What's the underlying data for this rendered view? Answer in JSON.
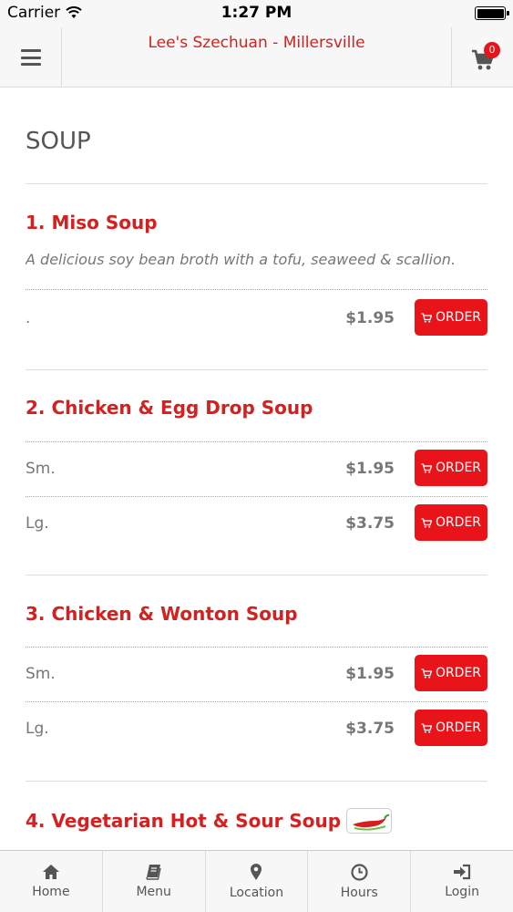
{
  "status_bar": {
    "carrier": "Carrier",
    "time": "1:27 PM"
  },
  "header": {
    "title": "Lee's Szechuan - Millersville",
    "cart_count": "0"
  },
  "category": "SOUP",
  "items": [
    {
      "name": "1. Miso Soup",
      "description": "A delicious soy bean broth with a tofu, seaweed & scallion.",
      "options": [
        {
          "label": ".",
          "price": "$1.95",
          "button": "ORDER"
        }
      ]
    },
    {
      "name": "2. Chicken & Egg Drop Soup",
      "options": [
        {
          "label": "Sm.",
          "price": "$1.95",
          "button": "ORDER"
        },
        {
          "label": "Lg.",
          "price": "$3.75",
          "button": "ORDER"
        }
      ]
    },
    {
      "name": "3. Chicken & Wonton Soup",
      "options": [
        {
          "label": "Sm.",
          "price": "$1.95",
          "button": "ORDER"
        },
        {
          "label": "Lg.",
          "price": "$3.75",
          "button": "ORDER"
        }
      ]
    },
    {
      "name": "4. Vegetarian Hot & Sour Soup",
      "icon": "spicy-pepper-icon"
    }
  ],
  "tabs": [
    {
      "label": "Home",
      "icon": "home-icon"
    },
    {
      "label": "Menu",
      "icon": "book-icon"
    },
    {
      "label": "Location",
      "icon": "map-pin-icon"
    },
    {
      "label": "Hours",
      "icon": "clock-icon"
    },
    {
      "label": "Login",
      "icon": "login-icon"
    }
  ],
  "colors": {
    "accent": "#d6201f",
    "button": "#e8141a",
    "bar_bg": "#f7f7f7"
  }
}
